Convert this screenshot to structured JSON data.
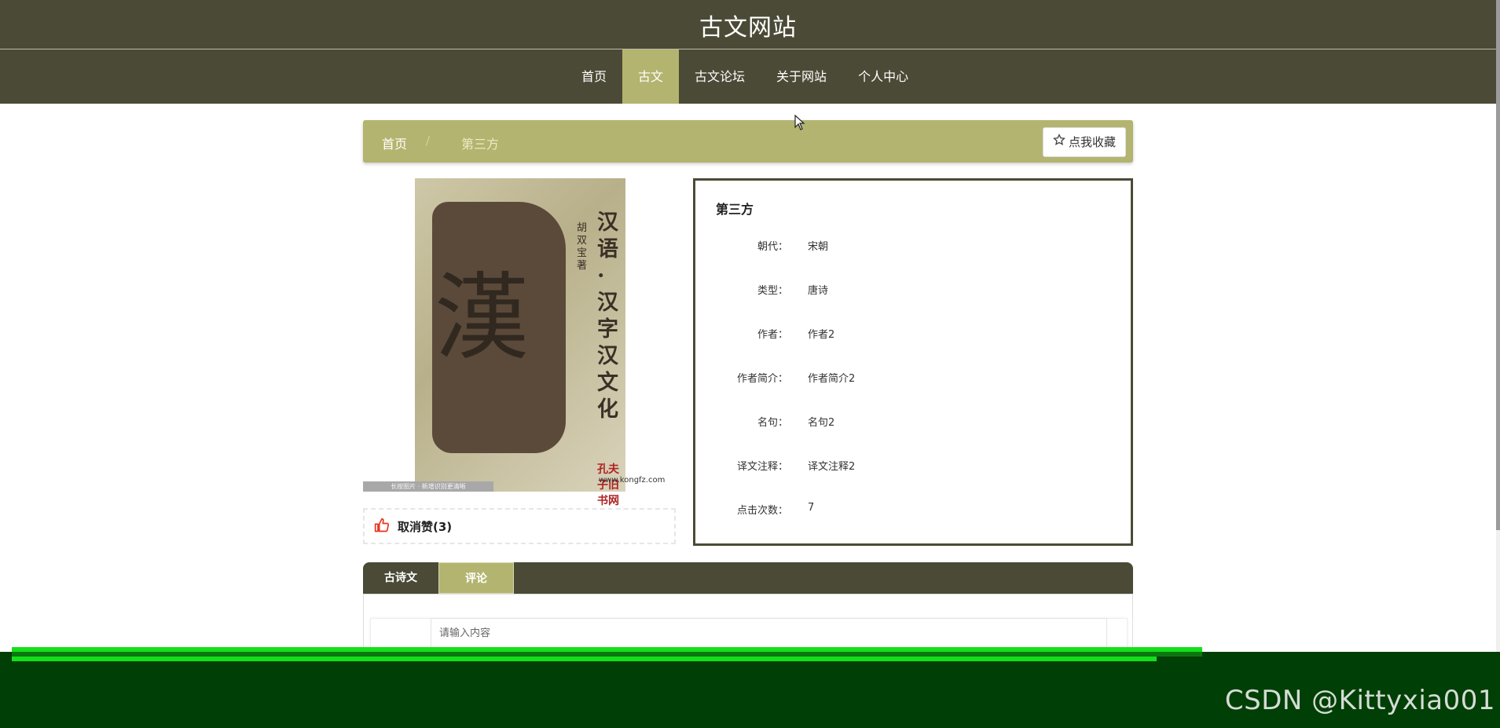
{
  "header": {
    "site_title": "古文网站"
  },
  "nav": {
    "items": [
      {
        "label": "首页",
        "active": false
      },
      {
        "label": "古文",
        "active": true
      },
      {
        "label": "古文论坛",
        "active": false
      },
      {
        "label": "关于网站",
        "active": false
      },
      {
        "label": "个人中心",
        "active": false
      }
    ]
  },
  "breadcrumb": {
    "home": "首页",
    "separator": "/",
    "current": "第三方"
  },
  "favorite_button": {
    "label": "点我收藏",
    "icon": "star-outline-icon"
  },
  "cover": {
    "title": "汉语·汉字汉文化",
    "author": "胡双宝著",
    "big_char": "漢",
    "brand": "孔夫子旧书网",
    "url": "www.kongfz.com",
    "caption": "长按图片 · 新增识别更清晰"
  },
  "like": {
    "label": "取消赞(3)",
    "icon": "thumbs-up-icon"
  },
  "detail": {
    "title": "第三方",
    "rows": [
      {
        "label": "朝代：",
        "value": "宋朝"
      },
      {
        "label": "类型：",
        "value": "唐诗"
      },
      {
        "label": "作者：",
        "value": "作者2"
      },
      {
        "label": "作者简介：",
        "value": "作者简介2"
      },
      {
        "label": "名句：",
        "value": "名句2"
      },
      {
        "label": "译文注释：",
        "value": "译文注释2"
      },
      {
        "label": "点击次数：",
        "value": "7"
      }
    ]
  },
  "tabs": [
    {
      "label": "古诗文",
      "active": false
    },
    {
      "label": "评论",
      "active": true
    }
  ],
  "comment": {
    "placeholder": "请输入内容"
  },
  "watermark": "CSDN @Kittyxia001",
  "colors": {
    "primary": "#4b4a36",
    "accent": "#b3b46f",
    "glitch": "#13e01a",
    "bottom": "#003f05"
  }
}
